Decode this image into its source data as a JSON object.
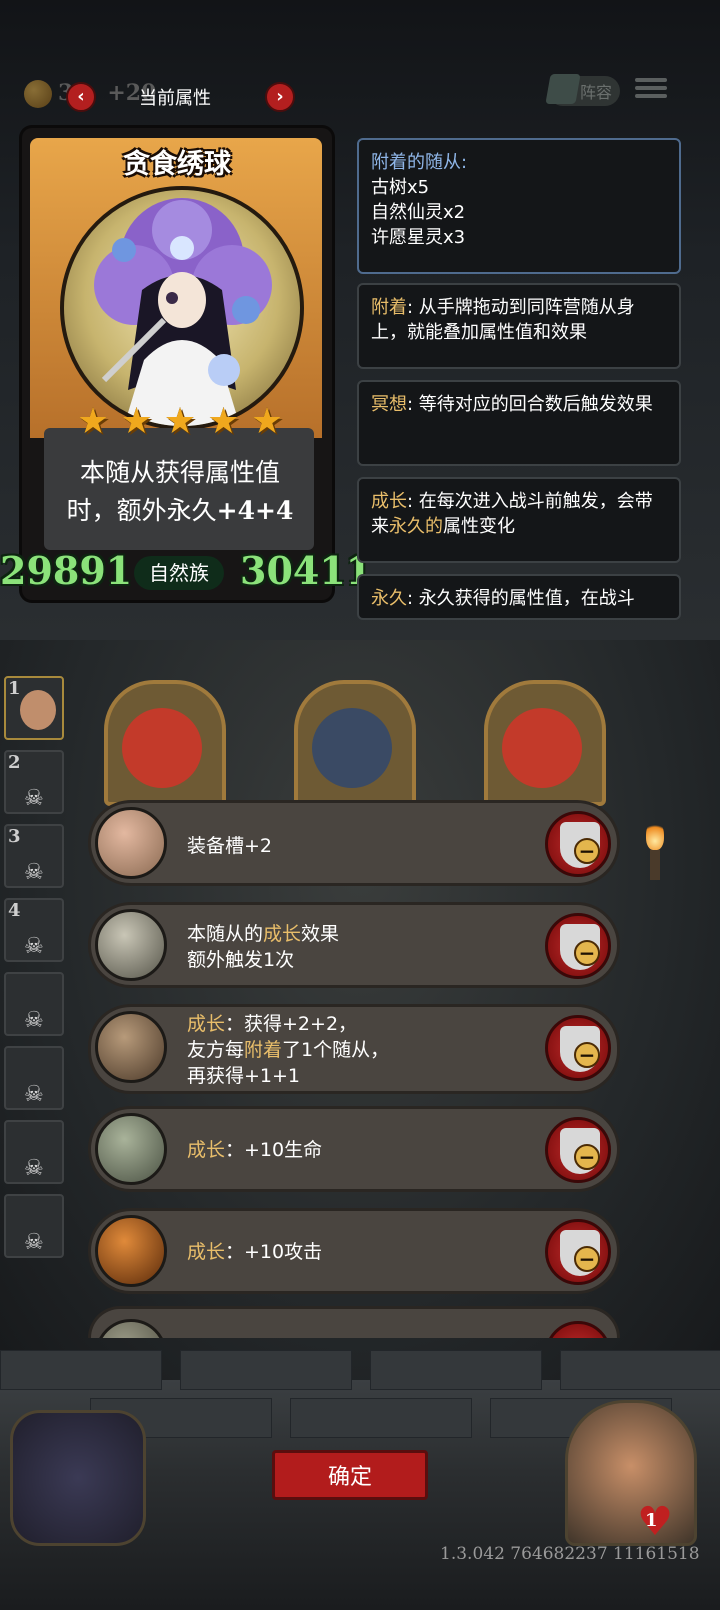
{
  "top_bar": {
    "gold_value": "3",
    "gold_bonus": "+20",
    "current_attributes_label": "当前属性",
    "prev_arrow": "‹",
    "next_arrow": "›",
    "lineup_label": "阵容"
  },
  "card": {
    "name": "贪食绣球",
    "stars": 5,
    "star_glyph": "★",
    "description_line1": "本随从获得属性值",
    "description_line2_prefix": "时，额外永久",
    "description_line2_value": "+4+4",
    "attack": "29891",
    "health": "30411",
    "tribe": "自然族"
  },
  "info_panels": {
    "attached": {
      "title": "附着的随从:",
      "items": [
        "古树x5",
        "自然仙灵x2",
        "许愿星灵x3"
      ]
    },
    "attach": {
      "keyword": "附着",
      "text": ": 从手牌拖动到同阵营随从身上，就能叠加属性值和效果"
    },
    "meditate": {
      "keyword": "冥想",
      "text": ": 等待对应的回合数后触发效果"
    },
    "growth": {
      "keyword": "成长",
      "text_before": ": 在每次进入战斗前触发，会带来",
      "highlight": "永久的",
      "text_after": "属性变化"
    },
    "permanent": {
      "keyword": "永久",
      "text": ": 永久获得的属性值，在战斗"
    }
  },
  "side_slots": [
    "1",
    "2",
    "3",
    "4",
    "",
    "",
    "",
    ""
  ],
  "effects": [
    {
      "icon": "pig-armor-icon",
      "line1": "装备槽+2",
      "line2": "",
      "line3": ""
    },
    {
      "icon": "stopwatch-gauntlet-icon",
      "line1_prefix": "本随从的",
      "line1_kw": "成长",
      "line1_suffix": "效果",
      "line2": "额外触发1次"
    },
    {
      "icon": "claw-gadget-icon",
      "kw": "成长",
      "line1": "：获得+2+2，",
      "line2_prefix": "友方每",
      "line2_kw": "附着",
      "line2_suffix": "了1个随从，",
      "line3": "再获得+1+1"
    },
    {
      "icon": "tombstone-icon",
      "kw": "成长",
      "line1": "：+10生命"
    },
    {
      "icon": "flaming-axe-icon",
      "kw": "成长",
      "line1": "：+10攻击"
    }
  ],
  "confirm_label": "确定",
  "hero_health": "1",
  "version": "1.3.042 764682237 11161518",
  "colors": {
    "keyword_gold": "#e9be6a",
    "keyword_blue": "#8fb6e8",
    "stat_green": "#8be27a",
    "button_red": "#b21c1c"
  }
}
